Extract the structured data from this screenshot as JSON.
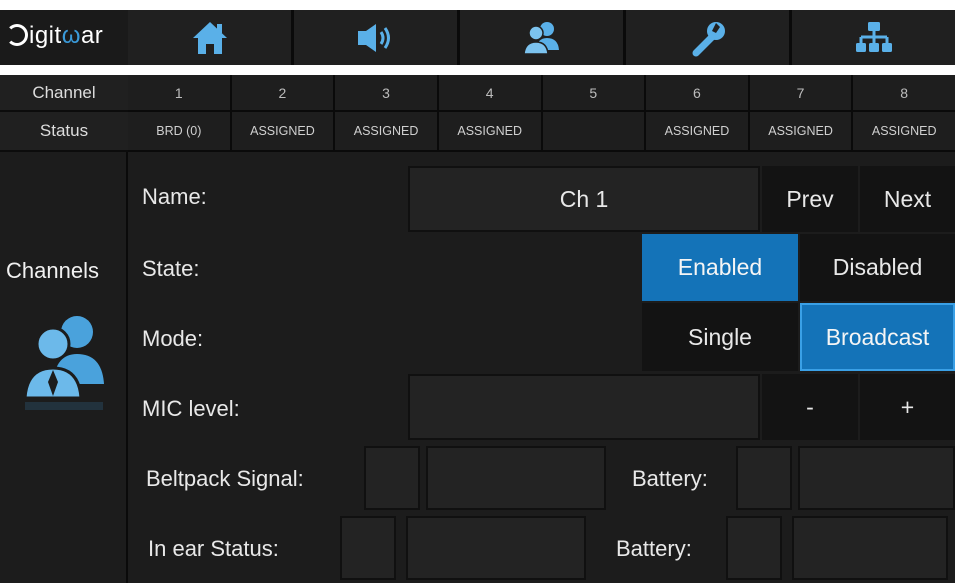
{
  "logo": {
    "prefix": "",
    "part1": "igit",
    "accent": "ω",
    "part2": "ar"
  },
  "nav": [
    "home-icon",
    "speaker-icon",
    "users-icon",
    "wrench-icon",
    "network-icon"
  ],
  "rows": {
    "channel_label": "Channel",
    "status_label": "Status"
  },
  "channels": [
    "1",
    "2",
    "3",
    "4",
    "5",
    "6",
    "7",
    "8"
  ],
  "statuses": [
    "BRD (0)",
    "ASSIGNED",
    "ASSIGNED",
    "ASSIGNED",
    "",
    "ASSIGNED",
    "ASSIGNED",
    "ASSIGNED"
  ],
  "sidebar": {
    "title": "Channels",
    "icon": "users-icon"
  },
  "form": {
    "name_label": "Name:",
    "name_value": "Ch 1",
    "prev": "Prev",
    "next": "Next",
    "state_label": "State:",
    "state_options": [
      "Enabled",
      "Disabled"
    ],
    "state_selected": "Enabled",
    "mode_label": "Mode:",
    "mode_options": [
      "Single",
      "Broadcast"
    ],
    "mode_selected": "Broadcast",
    "mic_label": "MIC level:",
    "mic_value": "",
    "minus": "-",
    "plus": "+",
    "beltpack_label": "Beltpack  Signal:",
    "beltpack_signal": "",
    "beltpack_battery_label": "Battery:",
    "inear_label": "In ear  Status:",
    "inear_status": "",
    "inear_battery_label": "Battery:"
  },
  "colors": {
    "selected": "#1473b8",
    "accent": "#3a9ad9"
  }
}
